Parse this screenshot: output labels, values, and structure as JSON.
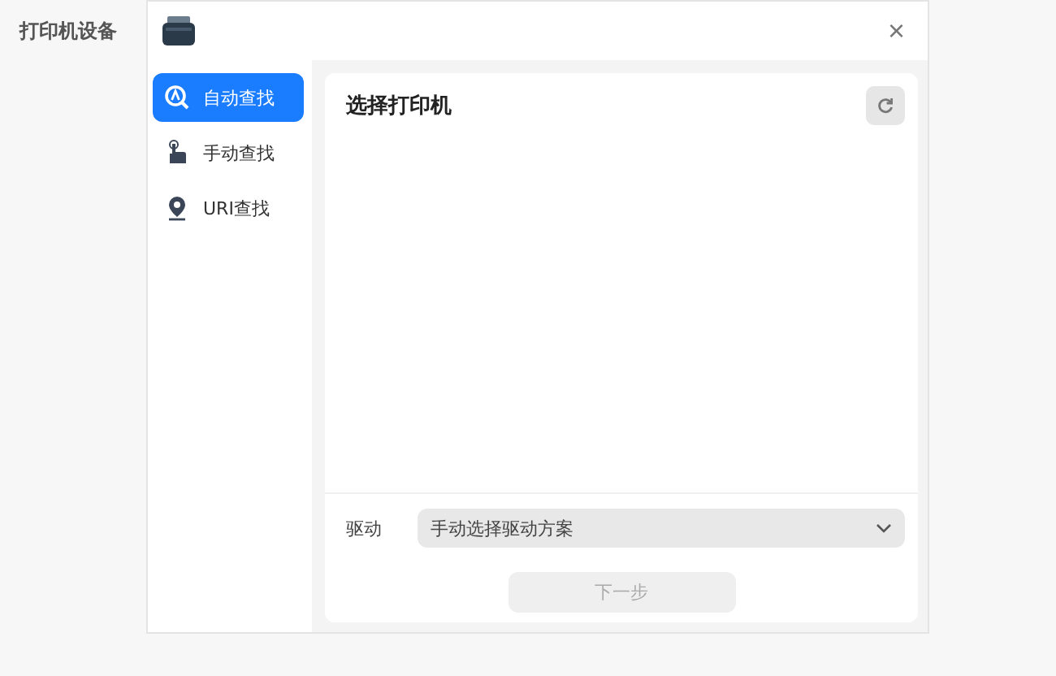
{
  "page_title": "打印机设备",
  "dialog": {
    "close": "×",
    "nav": [
      {
        "label": "自动查找",
        "kind": "auto",
        "selected": true
      },
      {
        "label": "手动查找",
        "kind": "manual",
        "selected": false
      },
      {
        "label": "URI查找",
        "kind": "uri",
        "selected": false
      }
    ],
    "panel_title": "选择打印机",
    "driver": {
      "label": "驱动",
      "value": "手动选择驱动方案"
    },
    "next_button": {
      "label": "下一步",
      "disabled": true
    }
  }
}
